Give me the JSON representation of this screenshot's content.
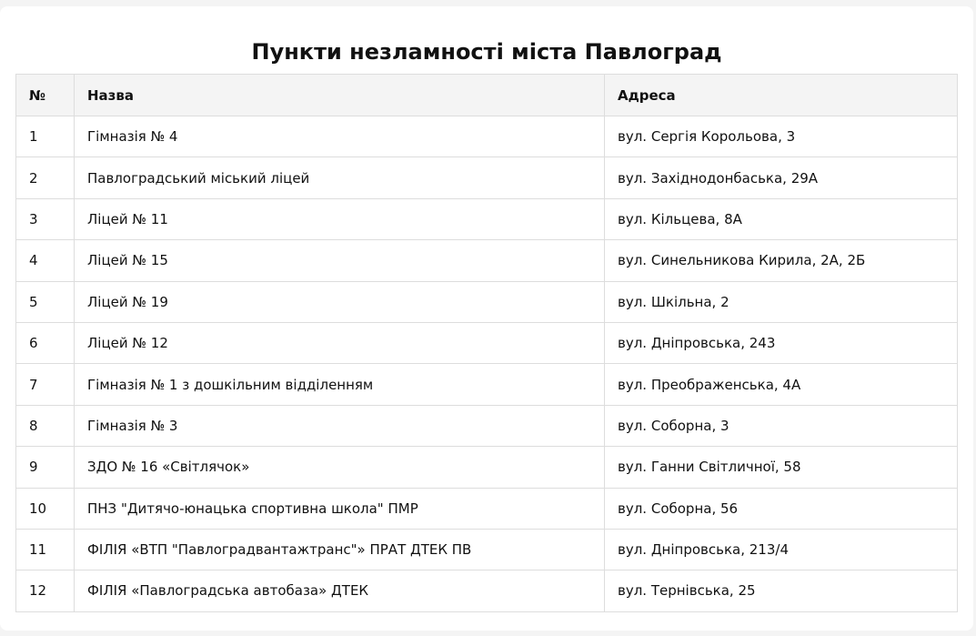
{
  "page": {
    "title": "Пункти незламності міста Павлоград"
  },
  "table": {
    "headers": [
      "№",
      "Назва",
      "Адреса"
    ],
    "rows": [
      {
        "num": "1",
        "name": "Гімназія № 4",
        "address": "вул. Сергія Корольова, 3"
      },
      {
        "num": "2",
        "name": "Павлоградський міський ліцей",
        "address": "вул. Західнодонбаська, 29А"
      },
      {
        "num": "3",
        "name": "Ліцей № 11",
        "address": "вул. Кільцева, 8А"
      },
      {
        "num": "4",
        "name": "Ліцей № 15",
        "address": "вул. Синельникова Кирила, 2А, 2Б"
      },
      {
        "num": "5",
        "name": "Ліцей № 19",
        "address": "вул. Шкільна, 2"
      },
      {
        "num": "6",
        "name": "Ліцей № 12",
        "address": "вул. Дніпровська, 243"
      },
      {
        "num": "7",
        "name": "Гімназія № 1 з дошкільним відділенням",
        "address": "вул. Преображенська, 4А"
      },
      {
        "num": "8",
        "name": "Гімназія № 3",
        "address": "вул. Соборна, 3"
      },
      {
        "num": "9",
        "name": "ЗДО № 16 «Світлячок»",
        "address": "вул. Ганни Світличної, 58"
      },
      {
        "num": "10",
        "name": "ПНЗ \"Дитячо-юнацька спортивна школа\" ПМР",
        "address": "вул. Соборна, 56"
      },
      {
        "num": "11",
        "name": "ФІЛІЯ «ВТП \"Павлоградвантажтранс\"» ПРАТ ДТЕК ПВ",
        "address": "вул. Дніпровська, 213/4"
      },
      {
        "num": "12",
        "name": "ФІЛІЯ «Павлоградська автобаза» ДТЕК",
        "address": "вул. Тернівська, 25"
      }
    ]
  }
}
